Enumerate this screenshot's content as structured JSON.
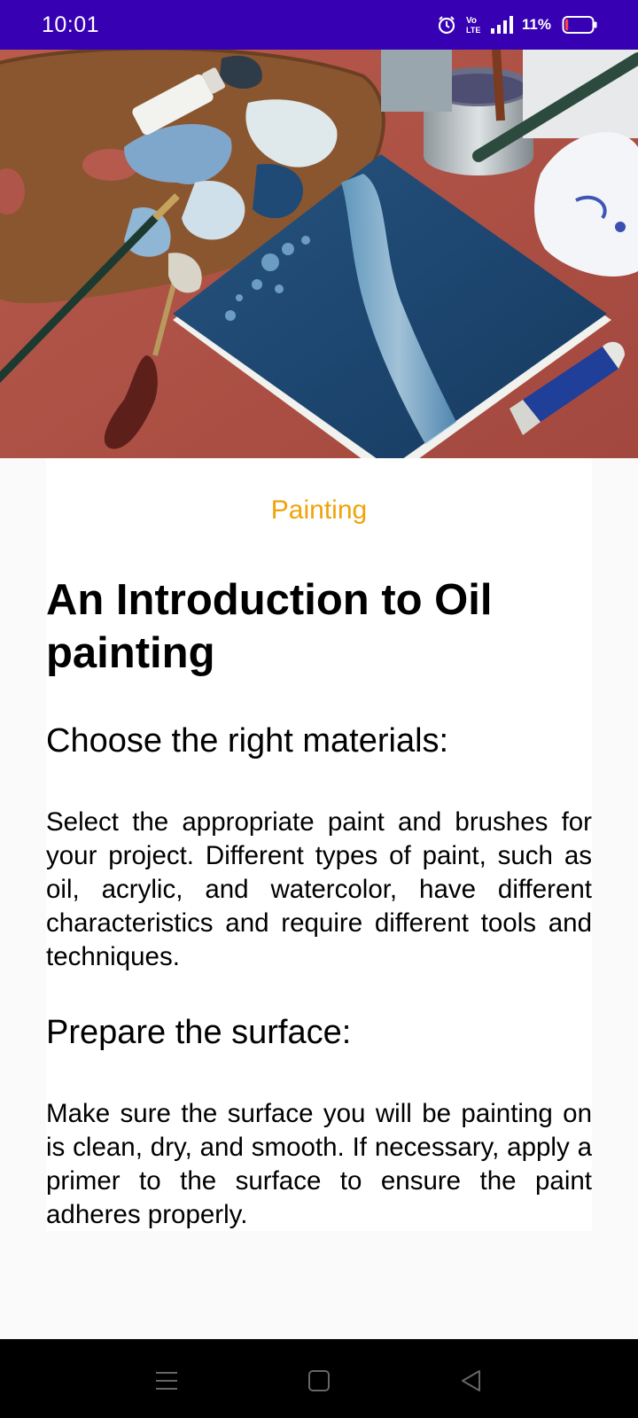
{
  "status_bar": {
    "time": "10:01",
    "battery_percent": "11%",
    "battery_level": 0.11,
    "volte_label": "Vo LTE",
    "icons": [
      "alarm-icon",
      "volte-icon",
      "signal-icon",
      "battery-icon"
    ]
  },
  "hero": {
    "icon": "oil-painting-photo"
  },
  "article": {
    "category": "Painting",
    "title": "An Introduction to Oil painting",
    "sections": [
      {
        "heading": "Choose the right materials:",
        "body": "Select the appropriate paint and brushes for your project. Different types of paint, such as oil, acrylic, and watercolor, have different characteristics and require different tools and techniques."
      },
      {
        "heading": "Prepare the surface:",
        "body": "Make sure the surface you will be painting on is clean, dry, and smooth. If necessary, apply a primer to the surface to ensure the paint adheres properly."
      }
    ]
  },
  "colors": {
    "status_bar": "#3700b3",
    "category": "#f0a30a",
    "background": "#fafafa",
    "nav_bar": "#000000"
  },
  "nav_bar": {
    "icons": [
      "menu-icon",
      "home-icon",
      "back-icon"
    ]
  }
}
